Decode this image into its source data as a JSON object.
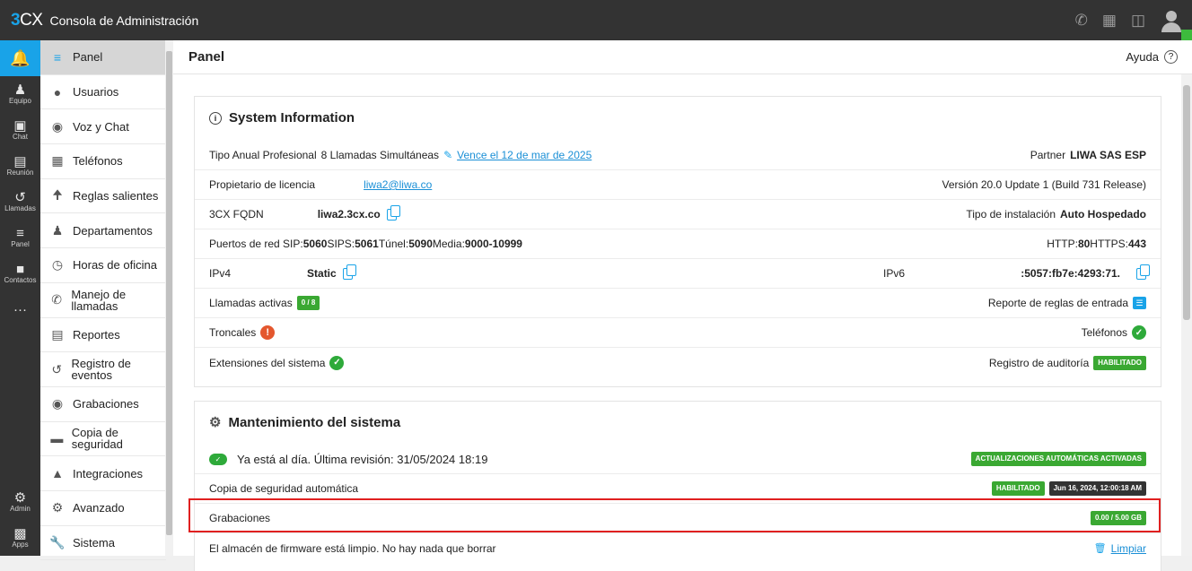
{
  "app": {
    "logo_3": "3",
    "logo_cx": "CX",
    "title": "Consola de Administración"
  },
  "rail": {
    "items": [
      {
        "label": "",
        "icon": "bell-icon"
      },
      {
        "label": "Equipo",
        "icon": "team-icon"
      },
      {
        "label": "Chat",
        "icon": "chat-icon"
      },
      {
        "label": "Reunión",
        "icon": "meeting-icon"
      },
      {
        "label": "Llamadas",
        "icon": "calls-icon"
      },
      {
        "label": "Panel",
        "icon": "panel-icon"
      },
      {
        "label": "Contactos",
        "icon": "contacts-icon"
      },
      {
        "label": "···",
        "icon": "more-icon"
      }
    ],
    "bottom": [
      {
        "label": "Admin",
        "icon": "gear-icon"
      },
      {
        "label": "Apps",
        "icon": "apps-icon"
      }
    ]
  },
  "nav": {
    "items": [
      {
        "label": "Panel",
        "icon": "dashboard-icon"
      },
      {
        "label": "Usuarios",
        "icon": "user-icon"
      },
      {
        "label": "Voz y Chat",
        "icon": "globe-icon"
      },
      {
        "label": "Teléfonos",
        "icon": "phone-grid-icon"
      },
      {
        "label": "Reglas salientes",
        "icon": "arrow-up-icon"
      },
      {
        "label": "Departamentos",
        "icon": "departments-icon"
      },
      {
        "label": "Horas de oficina",
        "icon": "clock-icon"
      },
      {
        "label": "Manejo de llamadas",
        "icon": "call-handling-icon"
      },
      {
        "label": "Reportes",
        "icon": "report-icon"
      },
      {
        "label": "Registro de eventos",
        "icon": "history-icon"
      },
      {
        "label": "Grabaciones",
        "icon": "record-icon"
      },
      {
        "label": "Copia de seguridad",
        "icon": "backup-icon"
      },
      {
        "label": "Integraciones",
        "icon": "puzzle-icon"
      },
      {
        "label": "Avanzado",
        "icon": "gear-icon"
      },
      {
        "label": "Sistema",
        "icon": "wrench-icon"
      }
    ]
  },
  "header": {
    "title": "Panel",
    "help": "Ayuda",
    "help_icon": "?"
  },
  "sysinfo": {
    "title": "System Information",
    "license_type": "Tipo Anual Profesional",
    "simultaneous": "8 Llamadas Simultáneas",
    "expiry_link": "Vence el 12 de mar de 2025",
    "partner_label": "Partner",
    "partner_value": "LIWA SAS ESP",
    "owner_label": "Propietario de licencia",
    "owner_email": "liwa2@liwa.co",
    "version": "Versión 20.0 Update 1 (Build 731 Release)",
    "fqdn_label": "3CX FQDN",
    "fqdn_value": "liwa2.3cx.co",
    "install_label": "Tipo de instalación",
    "install_value": "Auto Hospedado",
    "ports_label": "Puertos de red SIP:",
    "sip": "5060",
    "sips_label": " SIPS:",
    "sips": "5061",
    "tunnel_label": " Túnel:",
    "tunnel": "5090",
    "media_label": " Media:",
    "media": "9000-10999",
    "http_label": "HTTP:",
    "http": "80",
    "https_label": " HTTPS:",
    "https": "443",
    "ipv4_label": "IPv4",
    "ipv4_value": "Static",
    "ipv6_label": "IPv6",
    "ipv6_value": ":5057:fb7e:4293:71.",
    "active_calls_label": "Llamadas activas",
    "active_calls_badge": "0 / 8",
    "inbound_report_label": "Reporte de reglas de entrada",
    "trunks_label": "Troncales",
    "phones_label": "Teléfonos",
    "extensions_label": "Extensiones del sistema",
    "audit_label": "Registro de auditoría",
    "audit_badge": "HABILITADO"
  },
  "maintenance": {
    "title": "Mantenimiento del sistema",
    "uptodate": "Ya está al día. Última revisión: 31/05/2024 18:19",
    "auto_updates_badge": "ACTUALIZACIONES AUTOMÁTICAS ACTIVADAS",
    "backup_label": "Copia de seguridad automática",
    "backup_badge": "HABILITADO",
    "backup_date": "Jun 16, 2024, 12:00:18 AM",
    "recordings_label": "Grabaciones",
    "recordings_badge": "0.00 / 5.00 GB",
    "firmware_label": "El almacén de firmware está limpio. No hay nada que borrar",
    "clean_link": "Limpiar"
  }
}
